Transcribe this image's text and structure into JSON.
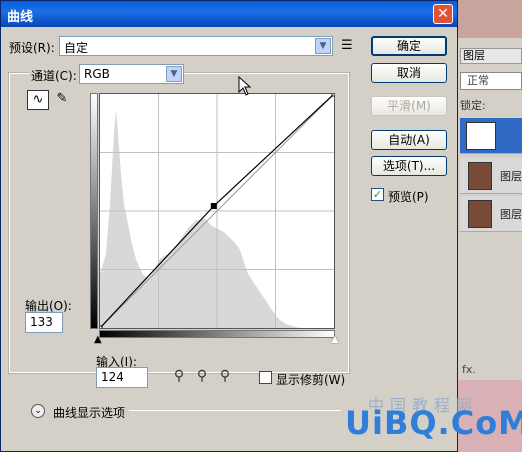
{
  "dialog": {
    "title": "曲线",
    "close_glyph": "✕"
  },
  "preset": {
    "label": "预设(R):",
    "value": "自定",
    "options_icon": "preset-options-icon"
  },
  "channel": {
    "label": "通道(C):",
    "value": "RGB"
  },
  "buttons": {
    "ok": "确定",
    "cancel": "取消",
    "smooth": "平滑(M)",
    "auto": "自动(A)",
    "options": "选项(T)..."
  },
  "preview": {
    "label": "预览(P)",
    "checked": true
  },
  "output": {
    "label": "输出(O):",
    "value": "133"
  },
  "input": {
    "label": "输入(I):",
    "value": "124"
  },
  "show_clipping": {
    "label": "显示修剪(W)",
    "checked": false
  },
  "curve_display_options": {
    "label": "曲线显示选项"
  },
  "curve": {
    "points": [
      [
        0,
        0
      ],
      [
        124,
        133
      ],
      [
        255,
        255
      ]
    ]
  },
  "background": {
    "layers_tab": "图层",
    "normal_field": "正常",
    "lock_label": "锁定:",
    "layer_labels": [
      "",
      "图层",
      "图层"
    ],
    "fx_label": "fx."
  },
  "watermark": {
    "text": "UiBQ.CoM",
    "cn_text": "中国教程网"
  },
  "colors": {
    "titlebar": "#0a5ed7",
    "dialog_bg": "#d4d0c8",
    "accent": "#2f7ed8"
  }
}
